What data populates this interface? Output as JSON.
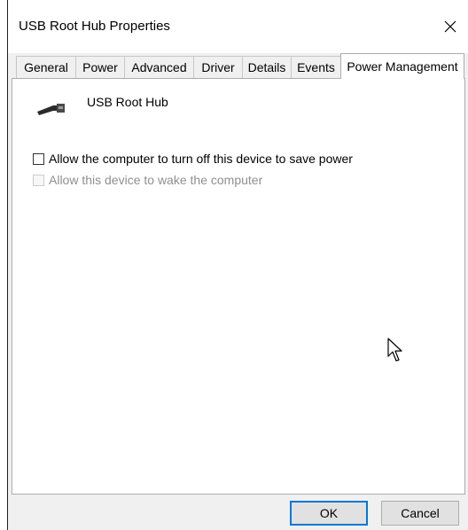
{
  "window": {
    "title": "USB Root Hub Properties",
    "close_icon": "close-icon"
  },
  "tabs": [
    {
      "label": "General",
      "active": false
    },
    {
      "label": "Power",
      "active": false
    },
    {
      "label": "Advanced",
      "active": false
    },
    {
      "label": "Driver",
      "active": false
    },
    {
      "label": "Details",
      "active": false
    },
    {
      "label": "Events",
      "active": false
    },
    {
      "label": "Power Management",
      "active": true
    }
  ],
  "device": {
    "icon": "usb-plug-icon",
    "name": "USB Root Hub"
  },
  "options": [
    {
      "label": "Allow the computer to turn off this device to save power",
      "checked": false,
      "enabled": true
    },
    {
      "label": "Allow this device to wake the computer",
      "checked": false,
      "enabled": false
    }
  ],
  "buttons": {
    "ok": "OK",
    "cancel": "Cancel"
  },
  "colors": {
    "accent": "#0078d7",
    "disabled_text": "#8f8f8f"
  },
  "cursor_icon": "mouse-pointer-icon"
}
